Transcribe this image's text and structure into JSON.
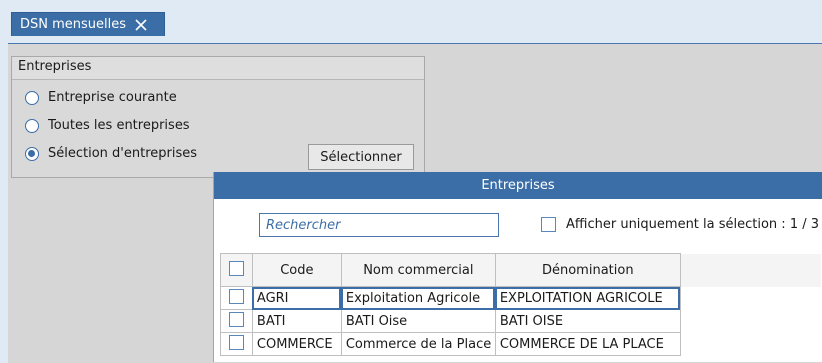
{
  "tab": {
    "title": "DSN mensuelles",
    "close_icon": "close-icon"
  },
  "group": {
    "title": "Entreprises",
    "options": [
      {
        "label": "Entreprise courante",
        "checked": false
      },
      {
        "label": "Toutes les entreprises",
        "checked": false
      },
      {
        "label": "Sélection d'entreprises",
        "checked": true
      }
    ],
    "select_button": "Sélectionner"
  },
  "dialog": {
    "title": "Entreprises",
    "search_placeholder": "Rechercher",
    "filter_label": "Afficher uniquement la sélection : 1 / 3",
    "columns": [
      "Code",
      "Nom commercial",
      "Dénomination"
    ],
    "rows": [
      {
        "code": "AGRI",
        "nom": "Exploitation Agricole",
        "denomination": "EXPLOITATION AGRICOLE"
      },
      {
        "code": "BATI",
        "nom": "BATI Oise",
        "denomination": "BATI OISE"
      },
      {
        "code": "COMMERCE",
        "nom": "Commerce de la Place",
        "denomination": "COMMERCE DE LA PLACE"
      }
    ]
  },
  "colors": {
    "accent": "#3b6ea7",
    "background": "#dfeaf5",
    "client": "#d6d6d6"
  }
}
